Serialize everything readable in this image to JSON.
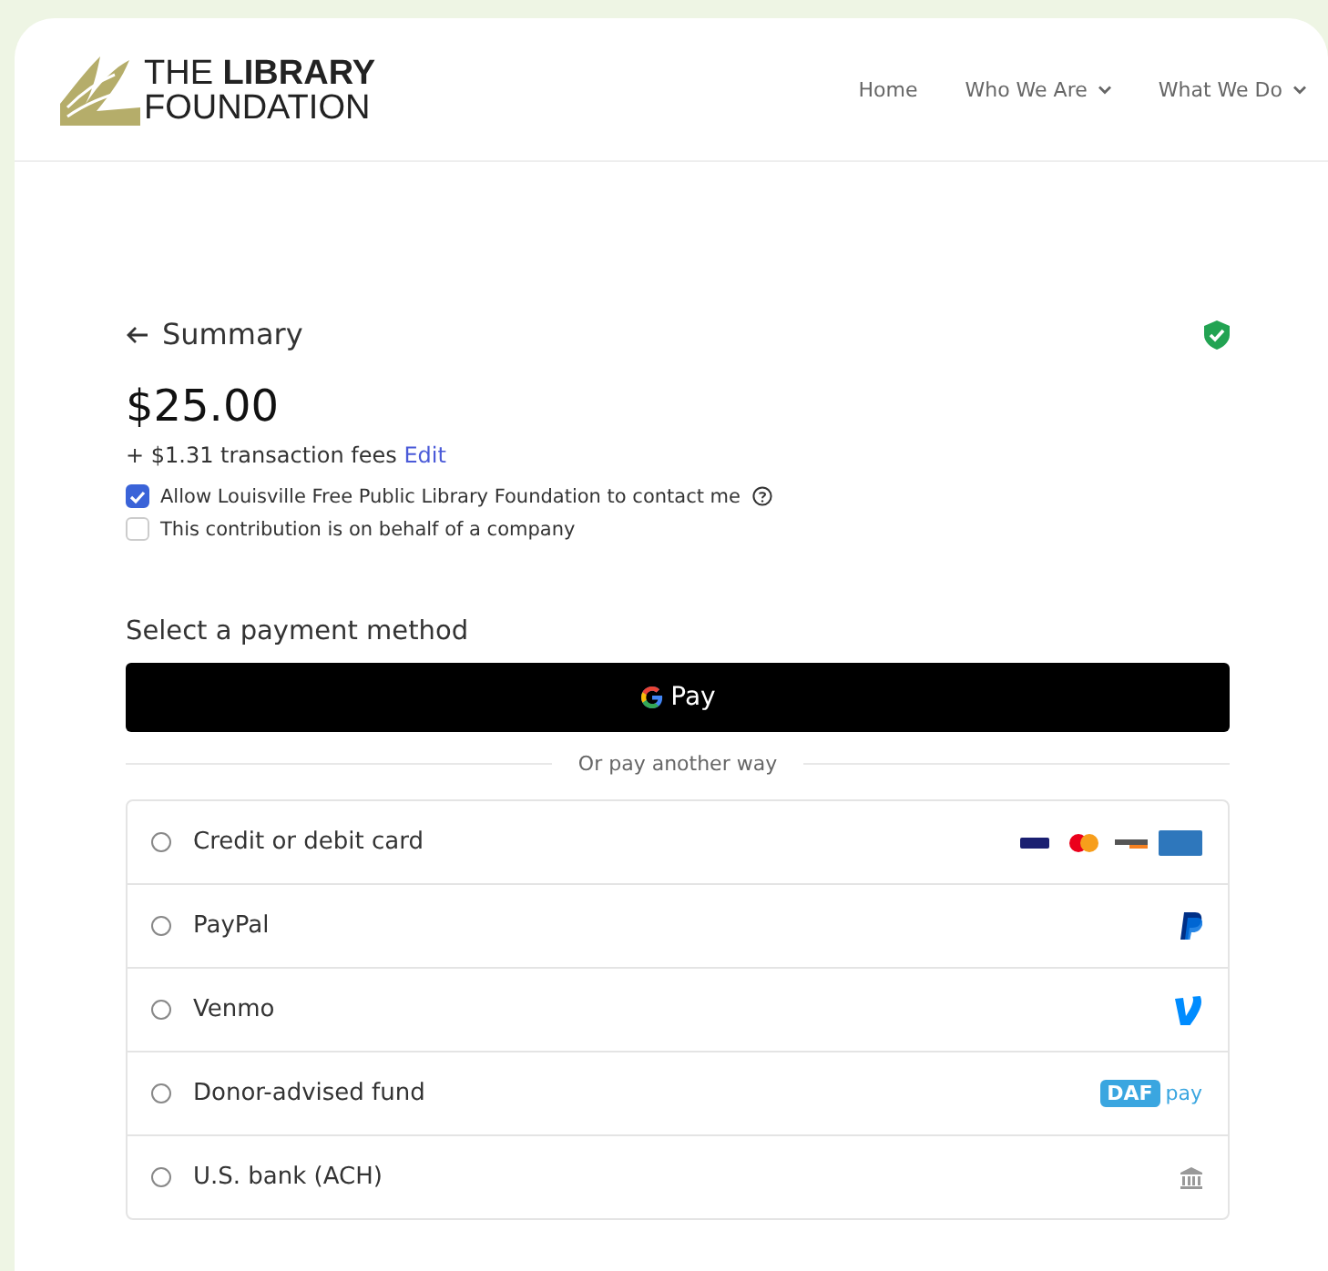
{
  "header": {
    "logo": {
      "line_1_light": "THE ",
      "line_1_bold": "LIBRARY",
      "line_2": "FOUNDATION"
    },
    "nav": [
      {
        "label": "Home",
        "dropdown": false
      },
      {
        "label": "Who We Are",
        "dropdown": true
      },
      {
        "label": "What We Do",
        "dropdown": true
      }
    ]
  },
  "summary": {
    "back_label": "Summary",
    "amount": "$25.00",
    "fees": "+ $1.31 transaction fees",
    "edit_link": "Edit",
    "options": [
      {
        "label": "Allow Louisville Free Public Library Foundation to contact me",
        "checked": true,
        "help": true
      },
      {
        "label": "This contribution is on behalf of a company",
        "checked": false,
        "help": false
      }
    ]
  },
  "payment": {
    "heading": "Select a payment method",
    "gpay_label": "Pay",
    "divider_label": "Or pay another way",
    "methods": [
      {
        "label": "Credit or debit card",
        "selected": false,
        "kind": "cards"
      },
      {
        "label": "PayPal",
        "selected": false,
        "kind": "paypal"
      },
      {
        "label": "Venmo",
        "selected": false,
        "kind": "venmo"
      },
      {
        "label": "Donor-advised fund",
        "selected": false,
        "kind": "daf",
        "badge": "DAF",
        "badge_text": "pay"
      },
      {
        "label": "U.S. bank (ACH)",
        "selected": false,
        "kind": "bank"
      }
    ]
  }
}
